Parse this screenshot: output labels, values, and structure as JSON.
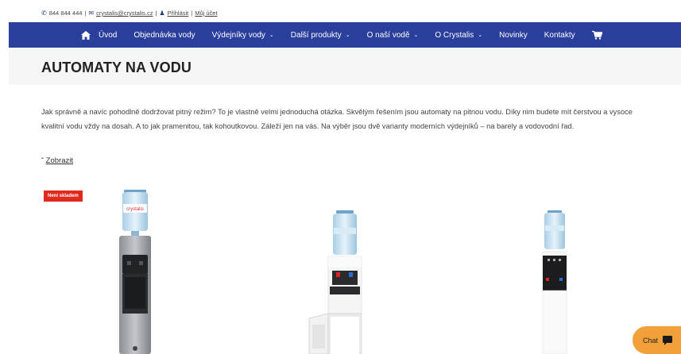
{
  "topbar": {
    "phone": "844 844 444",
    "separator": "|",
    "email": "crystalis@crystalis.cz",
    "login": "Přihlásit",
    "account": "Můj účet"
  },
  "nav": {
    "items": [
      {
        "label": "Úvod",
        "has_dropdown": false
      },
      {
        "label": "Objednávka vody",
        "has_dropdown": false
      },
      {
        "label": "Výdejníky vody",
        "has_dropdown": true
      },
      {
        "label": "Další produkty",
        "has_dropdown": true
      },
      {
        "label": "O naší vodě",
        "has_dropdown": true
      },
      {
        "label": "O Crystalis",
        "has_dropdown": true
      },
      {
        "label": "Novinky",
        "has_dropdown": false
      },
      {
        "label": "Kontakty",
        "has_dropdown": false
      }
    ],
    "background": "#2a3e9c"
  },
  "page": {
    "title": "AUTOMATY NA VODU",
    "description": "Jak správně a navíc pohodlně dodržovat pitný režim? To je vlastně velmi jednoduchá otázka. Skvělým řešením jsou automaty na pitnou vodu. Díky nim budete mít čerstvou a vysoce kvalitní vodu vždy na dosah. A to jak pramenitou, tak kohoutkovou. Záleží jen na vás. Na výběr jsou dvě varianty moderních výdejníků – na barely a vodovodní řad.",
    "toggle_label": "Zobrazit"
  },
  "products": {
    "badge": "Není skladem",
    "bottle_brand": "crystalis"
  },
  "chat": {
    "label": "Chat",
    "color": "#f2a13a"
  }
}
